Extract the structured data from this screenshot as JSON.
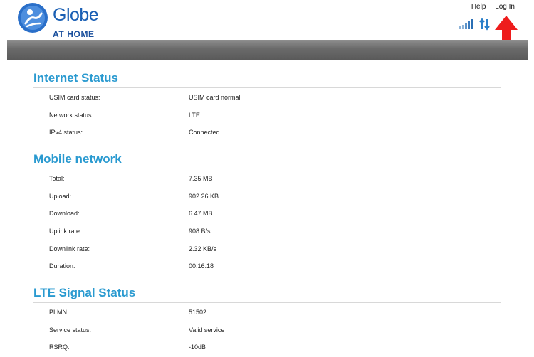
{
  "header": {
    "brand": "Globe",
    "brand_sub": "AT HOME",
    "help_label": "Help",
    "login_label": "Log In",
    "colors": {
      "brand": "#1a5fb4",
      "accent": "#2a9ad0",
      "arrow": "#ee1c1c"
    },
    "icons": [
      "globe-logo-icon",
      "signal-strength-icon",
      "data-transfer-icon",
      "red-arrow-icon"
    ]
  },
  "internet_status": {
    "title": "Internet Status",
    "rows": [
      {
        "label": "USIM card status:",
        "value": "USIM card normal"
      },
      {
        "label": "Network status:",
        "value": "LTE"
      },
      {
        "label": "IPv4 status:",
        "value": "Connected"
      }
    ]
  },
  "mobile_network": {
    "title": "Mobile network",
    "rows": [
      {
        "label": "Total:",
        "value": "7.35 MB"
      },
      {
        "label": "Upload:",
        "value": "902.26 KB"
      },
      {
        "label": "Download:",
        "value": "6.47 MB"
      },
      {
        "label": "Uplink rate:",
        "value": "908 B/s"
      },
      {
        "label": "Downlink rate:",
        "value": "2.32 KB/s"
      },
      {
        "label": "Duration:",
        "value": "00:16:18"
      }
    ]
  },
  "lte_signal": {
    "title": "LTE Signal Status",
    "rows": [
      {
        "label": "PLMN:",
        "value": "51502"
      },
      {
        "label": "Service status:",
        "value": "Valid service"
      },
      {
        "label": "RSRQ:",
        "value": "-10dB"
      }
    ]
  }
}
